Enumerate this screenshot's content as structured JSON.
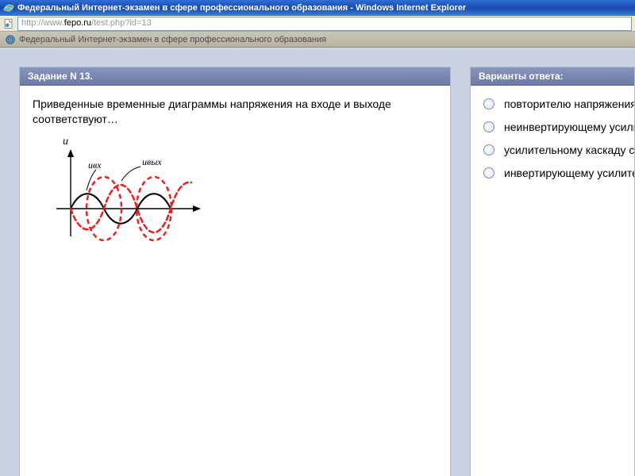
{
  "window": {
    "title": "Федеральный Интернет-экзамен в сфере профессионального образования - Windows Internet Explorer"
  },
  "address": {
    "prefix": "http://www.",
    "host": "fepo.ru",
    "suffix": "/test.php?id=13"
  },
  "tab": {
    "title": "Федеральный Интернет-экзамен в сфере профессионального образования"
  },
  "question": {
    "header": "Задание N 13.",
    "text": "Приведенные временные диаграммы напряжения на входе и выходе соответствуют…",
    "diagram": {
      "y_label": "u",
      "input_label": "uвх",
      "output_label": "uвых"
    }
  },
  "answers": {
    "header": "Варианты ответа:",
    "items": [
      "повторителю напряжения на о",
      "неинвертирующему усилител",
      "усилительному каскаду с общ",
      "инвертирующему усилителю "
    ]
  }
}
